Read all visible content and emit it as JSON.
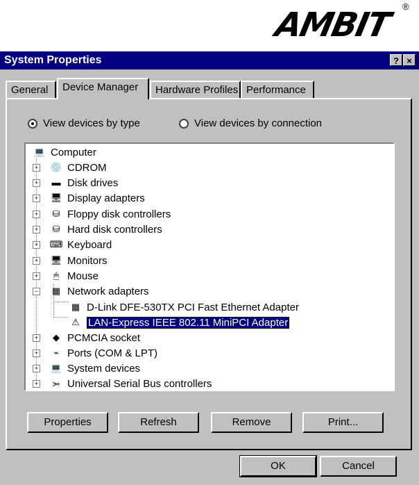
{
  "logo": {
    "text": "AMBIT",
    "mark": "®"
  },
  "window": {
    "title": "System Properties",
    "help_label": "?",
    "close_label": "×"
  },
  "tabs": [
    {
      "label": "General"
    },
    {
      "label": "Device Manager"
    },
    {
      "label": "Hardware Profiles"
    },
    {
      "label": "Performance"
    }
  ],
  "view": {
    "by_type": "View devices by type",
    "by_connection": "View devices by connection"
  },
  "tree": {
    "root": "Computer",
    "items": [
      "CDROM",
      "Disk drives",
      "Display adapters",
      "Floppy disk controllers",
      "Hard disk controllers",
      "Keyboard",
      "Monitors",
      "Mouse",
      "Network adapters",
      "PCMCIA socket",
      "Ports (COM & LPT)",
      "System devices",
      "Universal Serial Bus controllers"
    ],
    "network_children": [
      "D-Link DFE-530TX PCI Fast Ethernet Adapter",
      "LAN-Express IEEE 802.11 MiniPCI Adapter"
    ]
  },
  "buttons": {
    "properties": "Properties",
    "refresh": "Refresh",
    "remove": "Remove",
    "print": "Print...",
    "ok": "OK",
    "cancel": "Cancel"
  },
  "colors": {
    "titlebar": "#000080",
    "face": "#c0c0c0",
    "selection": "#000080"
  }
}
